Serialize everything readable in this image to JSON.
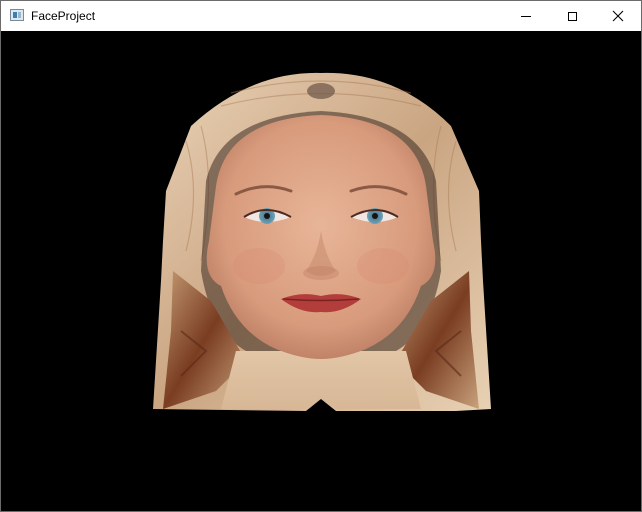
{
  "window": {
    "title": "FaceProject",
    "icon": "app-window-icon",
    "controls": [
      {
        "name": "minimize",
        "icon": "minimize-icon"
      },
      {
        "name": "maximize",
        "icon": "maximize-icon"
      },
      {
        "name": "close",
        "icon": "close-icon"
      }
    ]
  },
  "viewport": {
    "background": "#000000",
    "content": "3d-face-render"
  }
}
